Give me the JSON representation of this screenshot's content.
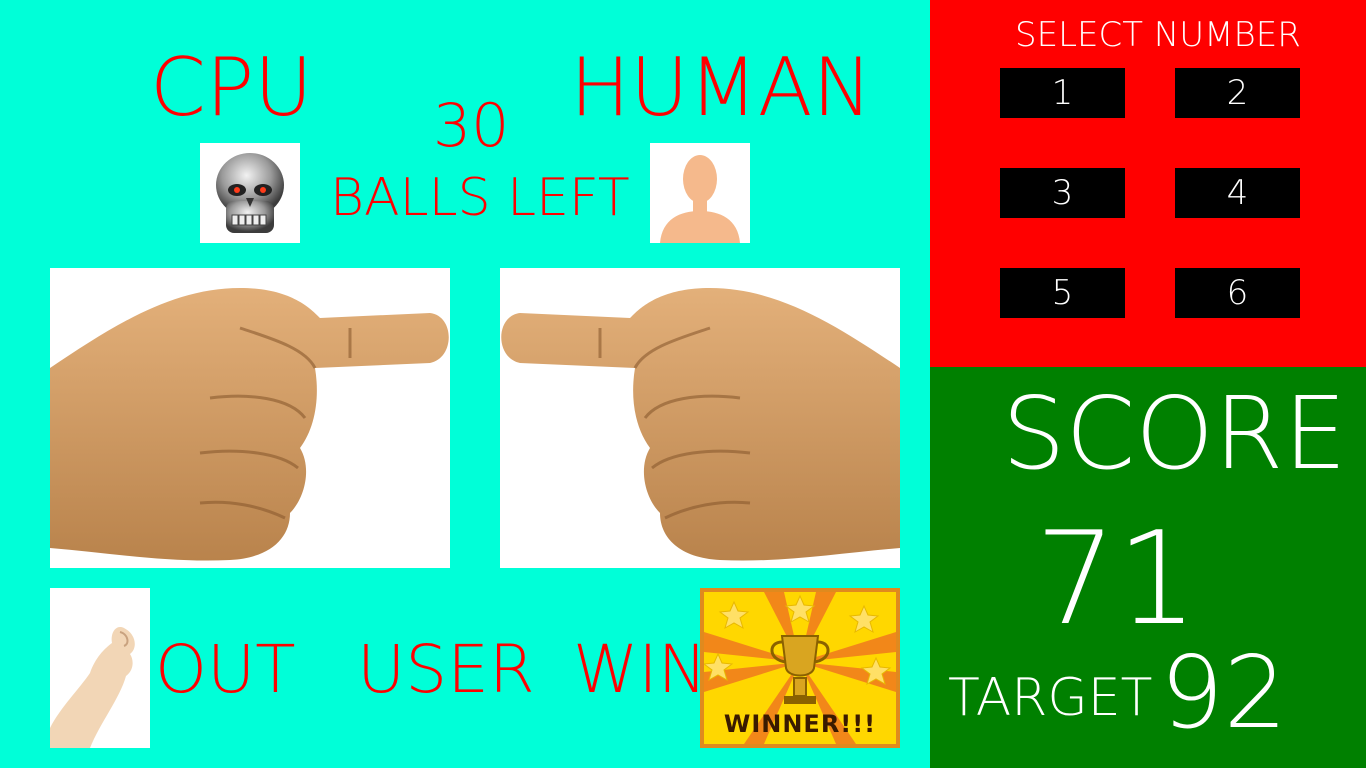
{
  "game": {
    "cpu_label": "CPU",
    "human_label": "HUMAN",
    "balls_left_value": "30",
    "balls_left_label": "BALLS  LEFT",
    "result_out": "OUT",
    "result_user": "USER",
    "result_win": "WIN",
    "winner_badge_text": "WINNER!!!"
  },
  "select": {
    "title": "SELECT  NUMBER",
    "buttons": [
      "1",
      "2",
      "3",
      "4",
      "5",
      "6"
    ]
  },
  "score": {
    "label": "SCORE",
    "value": "71",
    "target_label": "TARGET",
    "target_value": "92"
  },
  "colors": {
    "stage_bg": "#00FFD8",
    "select_bg": "#FF0000",
    "score_bg": "#008000",
    "label_red": "#FF0000"
  },
  "icons": {
    "cpu_avatar": "robot-skull-icon",
    "human_avatar": "human-silhouette-icon",
    "cpu_hand": "pointing-hand-right",
    "human_hand": "pointing-hand-left",
    "out_hand": "raised-finger-hand",
    "winner": "trophy-icon"
  }
}
